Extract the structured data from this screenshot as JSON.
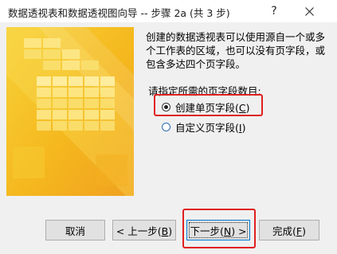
{
  "window": {
    "title": "数据透视表和数据透视图向导 -- 步骤 2a (共 3 步)",
    "help_label": "?",
    "close_icon": "close-icon"
  },
  "content": {
    "description": "创建的数据透视表可以使用源自一个或多个工作表的区域，也可以没有页字段，或包含多达四个页字段。",
    "prompt": "请指定所需的页字段数目:",
    "options": [
      {
        "label": "创建单页字段(",
        "mnemonic": "C",
        "suffix": ")",
        "selected": true
      },
      {
        "label": "自定义页字段(",
        "mnemonic": "I",
        "suffix": ")",
        "selected": false
      }
    ]
  },
  "buttons": {
    "cancel": {
      "label": "取消"
    },
    "back": {
      "prefix": "< 上一步(",
      "mnemonic": "B",
      "suffix": ")"
    },
    "next": {
      "prefix": "下一步(",
      "mnemonic": "N",
      "suffix": ") >"
    },
    "finish": {
      "prefix": "完成(",
      "mnemonic": "F",
      "suffix": ")"
    }
  },
  "colors": {
    "highlight": "#e02020",
    "focus_border": "#0078d7",
    "image_yellow": "#f5c518",
    "image_orange": "#f0a020"
  }
}
